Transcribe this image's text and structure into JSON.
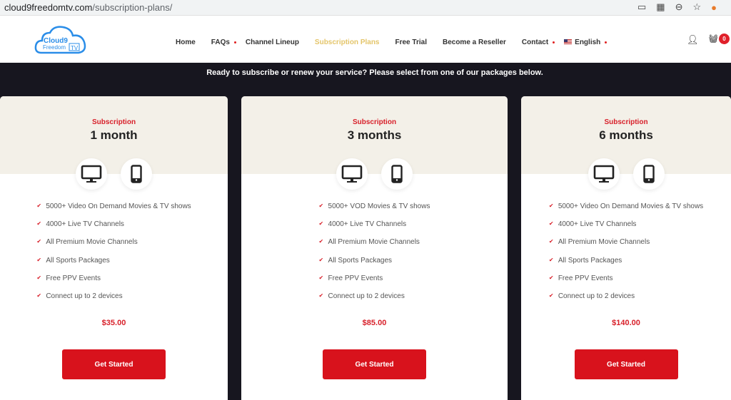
{
  "browser": {
    "url_domain": "cloud9freedomtv.com",
    "url_path": "/subscription-plans/"
  },
  "logo": {
    "line1": "Cloud9",
    "line2": "Freedom",
    "line3": "TV"
  },
  "nav": [
    {
      "label": "Home"
    },
    {
      "label": "FAQs"
    },
    {
      "label": "Channel Lineup"
    },
    {
      "label": "Subscription Plans",
      "active": true
    },
    {
      "label": "Free Trial"
    },
    {
      "label": "Become a Reseller"
    },
    {
      "label": "Contact"
    },
    {
      "label": "English"
    }
  ],
  "cart": {
    "count": "0"
  },
  "tagline": "Ready to subscribe or renew your service? Please select from one of our packages below.",
  "colors": {
    "accent": "#d8121c",
    "active_nav": "#e4c56a",
    "band": "#17161f",
    "card_header": "#f3f0e8"
  },
  "plans": [
    {
      "label": "Subscription",
      "duration": "1 month",
      "features": [
        "5000+ Video On Demand Movies & TV shows",
        "4000+ Live TV Channels",
        "All Premium Movie Channels",
        "All Sports Packages",
        "Free PPV Events",
        "Connect up to 2 devices"
      ],
      "price": "$35.00",
      "button": "Get Started"
    },
    {
      "label": "Subscription",
      "duration": "3 months",
      "features": [
        "5000+ VOD Movies & TV shows",
        "4000+ Live TV Channels",
        "All Premium Movie Channels",
        "All Sports Packages",
        "Free PPV Events",
        "Connect up to 2 devices"
      ],
      "price": "$85.00",
      "button": "Get Started"
    },
    {
      "label": "Subscription",
      "duration": "6 months",
      "features": [
        "5000+ Video On Demand Movies & TV shows",
        "4000+ Live TV Channels",
        "All Premium Movie Channels",
        "All Sports Packages",
        "Free PPV Events",
        "Connect up to 2 devices"
      ],
      "price": "$140.00",
      "button": "Get Started"
    }
  ]
}
